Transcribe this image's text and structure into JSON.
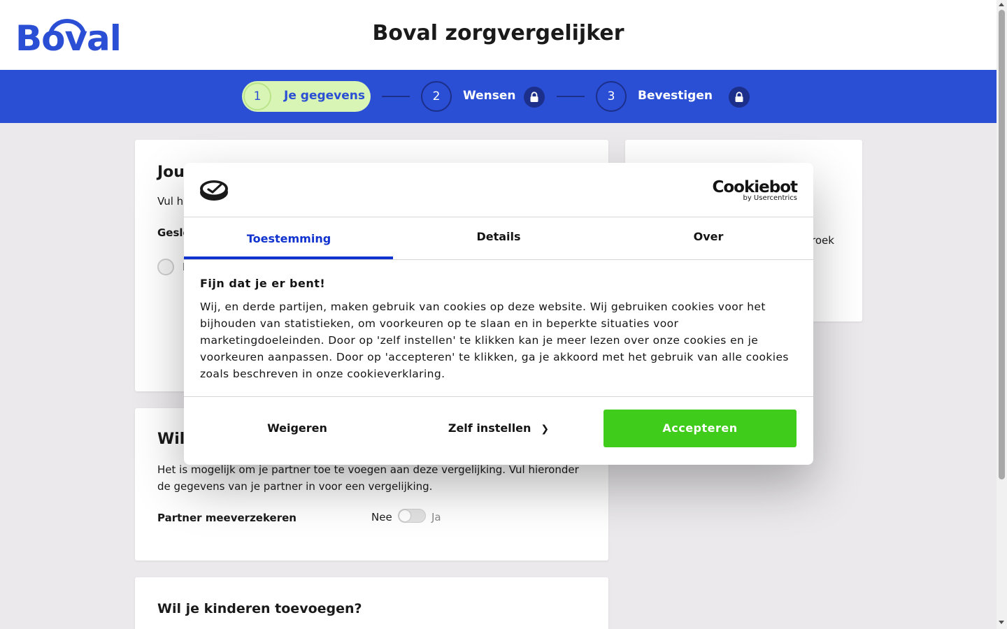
{
  "header": {
    "logo_text": "Boval",
    "title": "Boval zorgvergelijker"
  },
  "stepper": {
    "steps": [
      {
        "number": "1",
        "label": "Je gegevens",
        "state": "active"
      },
      {
        "number": "2",
        "label": "Wensen",
        "state": "locked"
      },
      {
        "number": "3",
        "label": "Bevestigen",
        "state": "locked"
      }
    ]
  },
  "background": {
    "card1": {
      "heading_visible": "Jouw",
      "text_visible": "Vul hi",
      "label_visible": "Geslo",
      "option_visible": "I"
    },
    "side_card": {
      "text_visible": "roek"
    },
    "card2": {
      "heading_visible": "Wil",
      "text": "Het is mogelijk om je partner toe te voegen aan deze vergelijking. Vul hieronder de gegevens van je partner in voor een vergelijking.",
      "partner_label": "Partner meeverzekeren",
      "toggle_off": "Nee",
      "toggle_on": "Ja",
      "toggle_value": false
    },
    "card3": {
      "heading": "Wil je kinderen toevoegen?"
    }
  },
  "cookie_dialog": {
    "brand_name": "Cookiebot",
    "brand_sub": "by Usercentrics",
    "tabs": [
      {
        "label": "Toestemming",
        "active": true
      },
      {
        "label": "Details",
        "active": false
      },
      {
        "label": "Over",
        "active": false
      }
    ],
    "heading": "Fijn dat je er bent!",
    "body": "Wij, en derde partijen, maken gebruik van cookies op deze website. Wij gebruiken cookies voor het bijhouden van statistieken, om voorkeuren op te slaan en in beperkte situaties voor marketingdoeleinden. Door op 'zelf instellen' te klikken kan je meer lezen over onze cookies en je voorkeuren aanpassen. Door op 'accepteren' te klikken, ga je akkoord met het gebruik van alle cookies zoals beschreven in onze cookieverklaring.",
    "buttons": {
      "decline": "Weigeren",
      "customize": "Zelf instellen",
      "accept": "Accepteren"
    }
  },
  "colors": {
    "brand_blue": "#2a4fd4",
    "step_active_bg": "#d9f5b5",
    "accept_green": "#40cc1b",
    "tab_active": "#1032cf",
    "page_bg": "#ebe9ec"
  }
}
